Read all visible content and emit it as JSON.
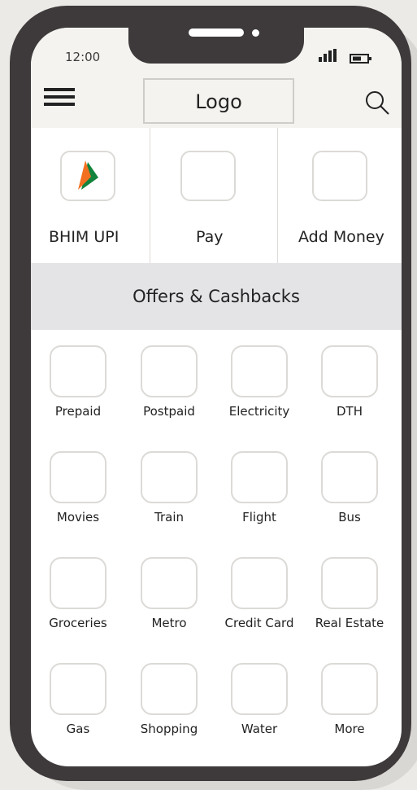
{
  "status_bar": {
    "time": "12:00"
  },
  "header": {
    "logo_text": "Logo"
  },
  "quick_actions": [
    {
      "label": "BHIM UPI",
      "icon": "bhim-upi-logo"
    },
    {
      "label": "Pay",
      "icon": "blank-tile"
    },
    {
      "label": "Add Money",
      "icon": "blank-tile"
    }
  ],
  "offers_banner": {
    "label": "Offers & Cashbacks"
  },
  "services": [
    "Prepaid",
    "Postpaid",
    "Electricity",
    "DTH",
    "Movies",
    "Train",
    "Flight",
    "Bus",
    "Groceries",
    "Metro",
    "Credit Card",
    "Real Estate",
    "Gas",
    "Shopping",
    "Water",
    "More"
  ],
  "colors": {
    "phone_frame": "#3e3a3b",
    "top_bar": "#f4f3f0",
    "offers_banner": "#e4e3e6",
    "bhim_orange": "#f37021",
    "bhim_green": "#12833c"
  }
}
